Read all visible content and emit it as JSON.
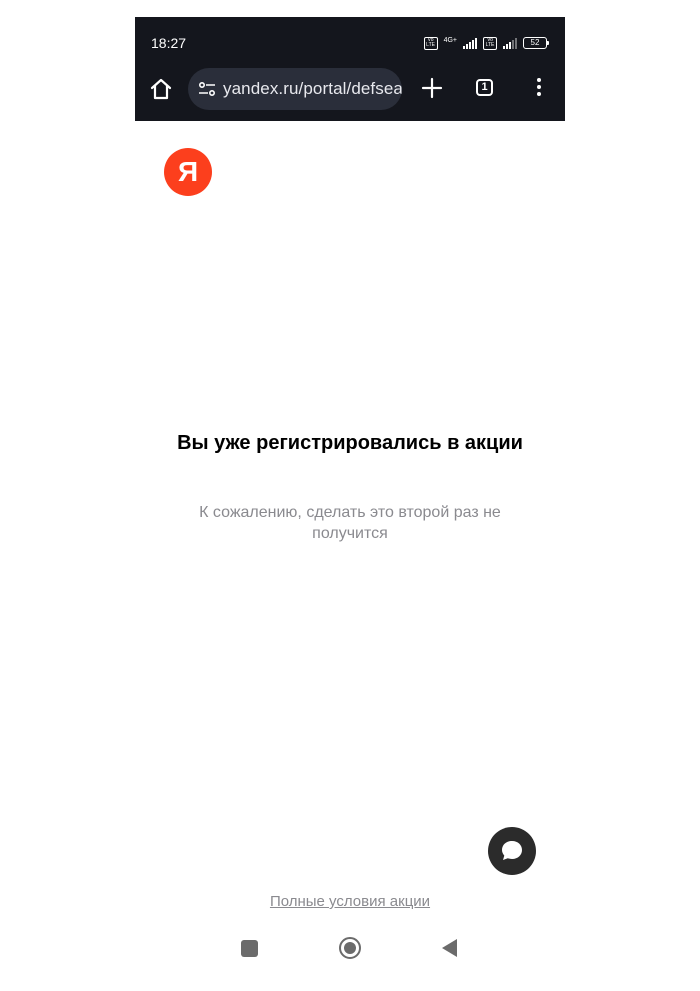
{
  "status_bar": {
    "time": "18:27",
    "network": "4G+",
    "volte_label": "Vo LTE",
    "battery": "52"
  },
  "browser": {
    "url": "yandex.ru/portal/defsearch",
    "tab_count": "1"
  },
  "page": {
    "logo_text": "Я",
    "title": "Вы уже регистрировались в акции",
    "subtitle": "К сожалению, сделать это второй раз не получится",
    "terms_link": "Полные условия акции"
  },
  "colors": {
    "top_bar_bg": "#14161d",
    "logo_red": "#fc3f1d",
    "muted_text": "#8a8a8f",
    "chat_button": "#2b2b2b"
  },
  "icons": [
    "home-icon",
    "site-settings-icon",
    "plus-icon",
    "tabs-icon",
    "more-icon",
    "chat-icon",
    "recents-icon",
    "home-nav-icon",
    "back-icon"
  ]
}
